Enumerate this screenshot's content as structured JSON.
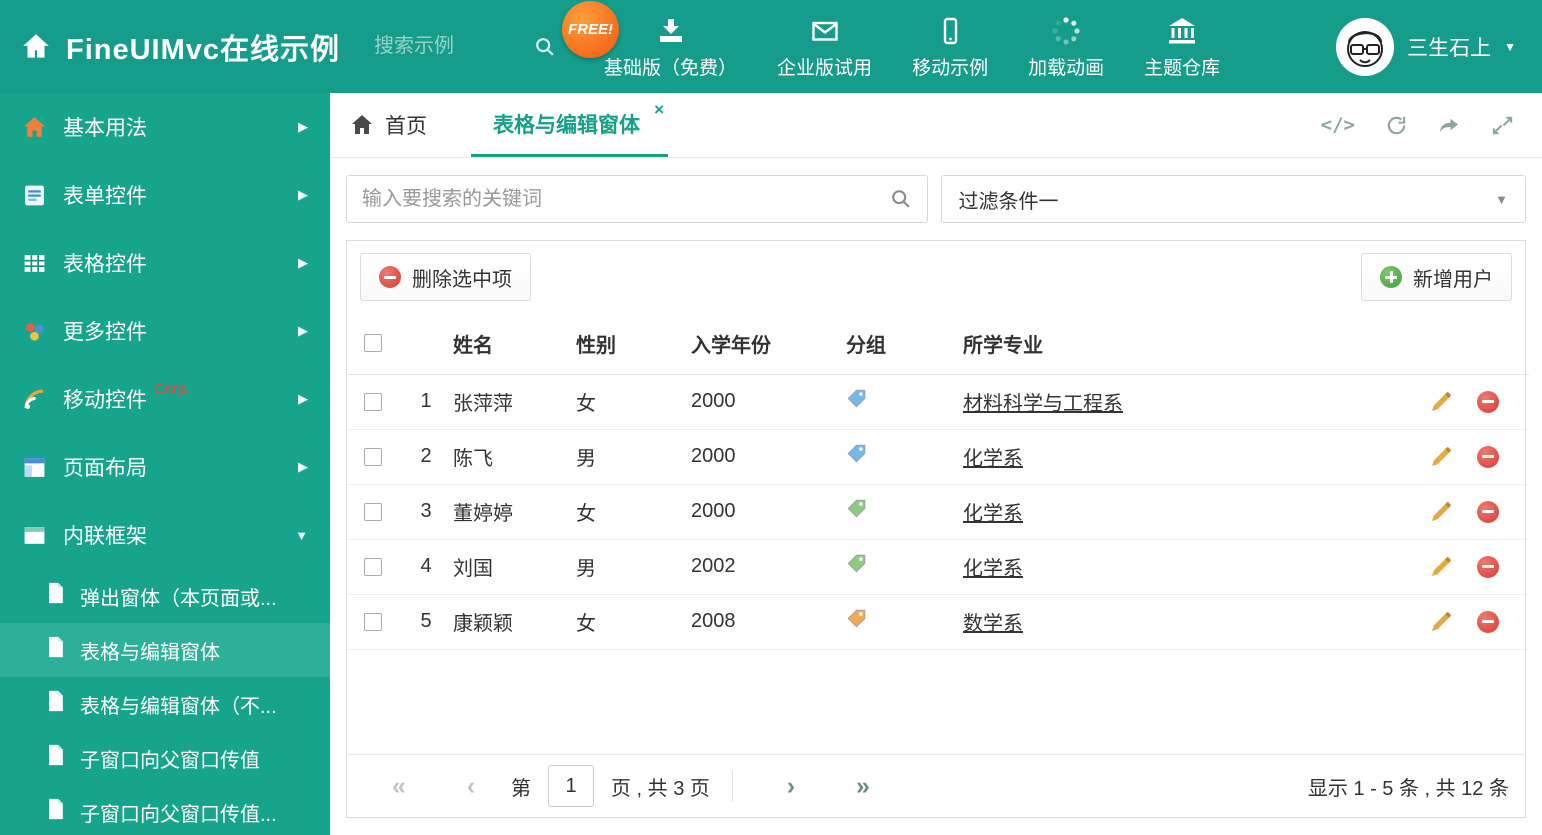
{
  "colors": {
    "header_bg": "#159c8b",
    "sidebar_bg": "#17a48c",
    "sidebar_active_bg": "#2db09a",
    "accent": "#16a085",
    "free_badge": "#f2590e",
    "danger": "#d63a32",
    "success": "#3f9c3c",
    "tag_blue": "#74b9e8",
    "tag_green": "#8fca84",
    "tag_orange": "#f2a951"
  },
  "header": {
    "title": "FineUIMvc在线示例",
    "search_placeholder": "搜索示例",
    "free_badge": "FREE!",
    "nav": [
      {
        "label": "基础版（免费）",
        "icon": "download-icon"
      },
      {
        "label": "企业版试用",
        "icon": "envelope-icon"
      },
      {
        "label": "移动示例",
        "icon": "mobile-icon"
      },
      {
        "label": "加载动画",
        "icon": "spinner-icon"
      },
      {
        "label": "主题仓库",
        "icon": "bank-icon"
      }
    ],
    "user_name": "三生石上"
  },
  "sidebar": {
    "items": [
      {
        "label": "基本用法",
        "icon": "home-icon"
      },
      {
        "label": "表单控件",
        "icon": "form-icon"
      },
      {
        "label": "表格控件",
        "icon": "table-icon"
      },
      {
        "label": "更多控件",
        "icon": "controls-icon"
      },
      {
        "label": "移动控件",
        "badge": "Corp.",
        "icon": "mobile-signal-icon"
      },
      {
        "label": "页面布局",
        "icon": "layout-icon"
      },
      {
        "label": "内联框架",
        "icon": "frame-icon"
      }
    ],
    "subitems": [
      {
        "label": "弹出窗体（本页面或..."
      },
      {
        "label": "表格与编辑窗体"
      },
      {
        "label": "表格与编辑窗体（不..."
      },
      {
        "label": "子窗口向父窗口传值"
      },
      {
        "label": "子窗口向父窗口传值..."
      }
    ]
  },
  "tabs": {
    "home": "首页",
    "active": "表格与编辑窗体"
  },
  "filter": {
    "search_placeholder": "输入要搜索的关键词",
    "selected_filter": "过滤条件一"
  },
  "toolbar": {
    "delete_label": "删除选中项",
    "add_label": "新增用户"
  },
  "table": {
    "headers": {
      "name": "姓名",
      "gender": "性别",
      "year": "入学年份",
      "group": "分组",
      "major": "所学专业"
    },
    "rows": [
      {
        "num": "1",
        "name": "张萍萍",
        "gender": "女",
        "year": "2000",
        "tag": "blue",
        "major": "材料科学与工程系"
      },
      {
        "num": "2",
        "name": "陈飞",
        "gender": "男",
        "year": "2000",
        "tag": "blue",
        "major": "化学系"
      },
      {
        "num": "3",
        "name": "董婷婷",
        "gender": "女",
        "year": "2000",
        "tag": "green",
        "major": "化学系"
      },
      {
        "num": "4",
        "name": "刘国",
        "gender": "男",
        "year": "2002",
        "tag": "green",
        "major": "化学系"
      },
      {
        "num": "5",
        "name": "康颖颖",
        "gender": "女",
        "year": "2008",
        "tag": "orange",
        "major": "数学系"
      }
    ]
  },
  "pagination": {
    "page_prefix": "第",
    "current_page": "1",
    "page_suffix": "页 , 共 3 页",
    "summary": "显示 1 - 5 条 , 共 12 条"
  }
}
